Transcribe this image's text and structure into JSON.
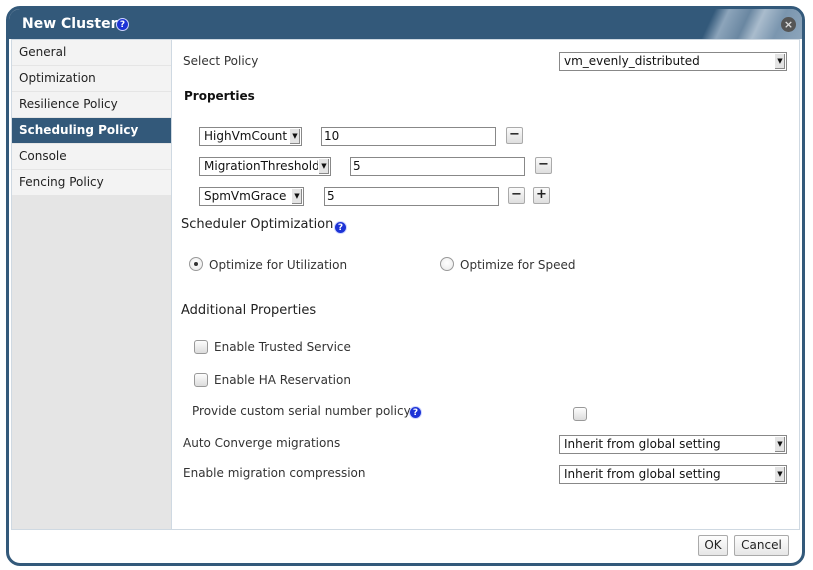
{
  "dialog": {
    "title": "New Cluster",
    "help_icon": "?",
    "close_icon": "×"
  },
  "sidebar": {
    "items": [
      {
        "label": "General",
        "active": false
      },
      {
        "label": "Optimization",
        "active": false
      },
      {
        "label": "Resilience Policy",
        "active": false
      },
      {
        "label": "Scheduling Policy",
        "active": true
      },
      {
        "label": "Console",
        "active": false
      },
      {
        "label": "Fencing Policy",
        "active": false
      }
    ]
  },
  "policy": {
    "label": "Select Policy",
    "value": "vm_evenly_distributed"
  },
  "properties": {
    "title": "Properties",
    "rows": [
      {
        "key": "HighVmCount",
        "value": "10",
        "buttons": [
          "−"
        ]
      },
      {
        "key": "MigrationThreshold",
        "value": "5",
        "buttons": [
          "−"
        ]
      },
      {
        "key": "SpmVmGrace",
        "value": "5",
        "buttons": [
          "−",
          "+"
        ]
      }
    ]
  },
  "scheduler_optimization": {
    "title": "Scheduler Optimization",
    "options": [
      {
        "label": "Optimize for Utilization",
        "checked": true
      },
      {
        "label": "Optimize for Speed",
        "checked": false
      }
    ]
  },
  "additional_properties": {
    "title": "Additional Properties",
    "trusted_service": {
      "label": "Enable Trusted Service",
      "checked": false
    },
    "ha_reservation": {
      "label": "Enable HA Reservation",
      "checked": false
    },
    "serial_number": {
      "label": "Provide custom serial number policy",
      "checked": false
    }
  },
  "migration": {
    "auto_converge": {
      "label": "Auto Converge migrations",
      "value": "Inherit from global setting"
    },
    "compression": {
      "label": "Enable migration compression",
      "value": "Inherit from global setting"
    }
  },
  "footer": {
    "ok_label": "OK",
    "cancel_label": "Cancel"
  },
  "icons": {
    "dropdown_arrow": "▼"
  }
}
